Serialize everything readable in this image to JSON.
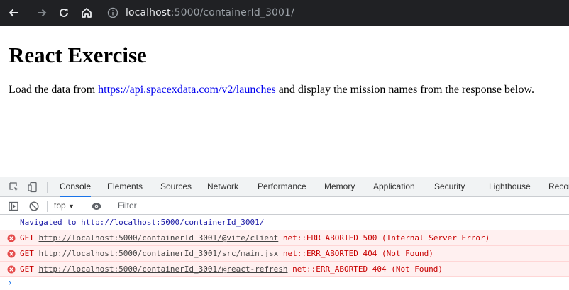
{
  "browser": {
    "url_host": "localhost",
    "url_rest": ":5000/containerId_3001/"
  },
  "page": {
    "title": "React Exercise",
    "text_before": "Load the data from ",
    "link": "https://api.spacexdata.com/v2/launches",
    "text_after": " and display the mission names from the response below."
  },
  "devtools": {
    "tabs": [
      "Console",
      "Elements",
      "Sources",
      "Network",
      "Performance",
      "Memory",
      "Application",
      "Security",
      "Lighthouse",
      "Recorder"
    ],
    "active_tab": "Console",
    "context": "top",
    "filter_placeholder": "Filter",
    "navigated": {
      "prefix": "Navigated to ",
      "url": "http://localhost:5000/containerId_3001/"
    },
    "errors": [
      {
        "method": "GET",
        "url": "http://localhost:5000/containerId_3001/@vite/client",
        "status": "net::ERR_ABORTED 500 (Internal Server Error)"
      },
      {
        "method": "GET",
        "url": "http://localhost:5000/containerId_3001/src/main.jsx",
        "status": "net::ERR_ABORTED 404 (Not Found)"
      },
      {
        "method": "GET",
        "url": "http://localhost:5000/containerId_3001/@react-refresh",
        "status": "net::ERR_ABORTED 404 (Not Found)"
      }
    ],
    "prompt": "›"
  },
  "colors": {
    "toolbar_bg": "#202124",
    "link": "#0000ee",
    "error_text": "#c80000",
    "error_bg": "#fff0f0",
    "accent": "#1a73e8"
  }
}
